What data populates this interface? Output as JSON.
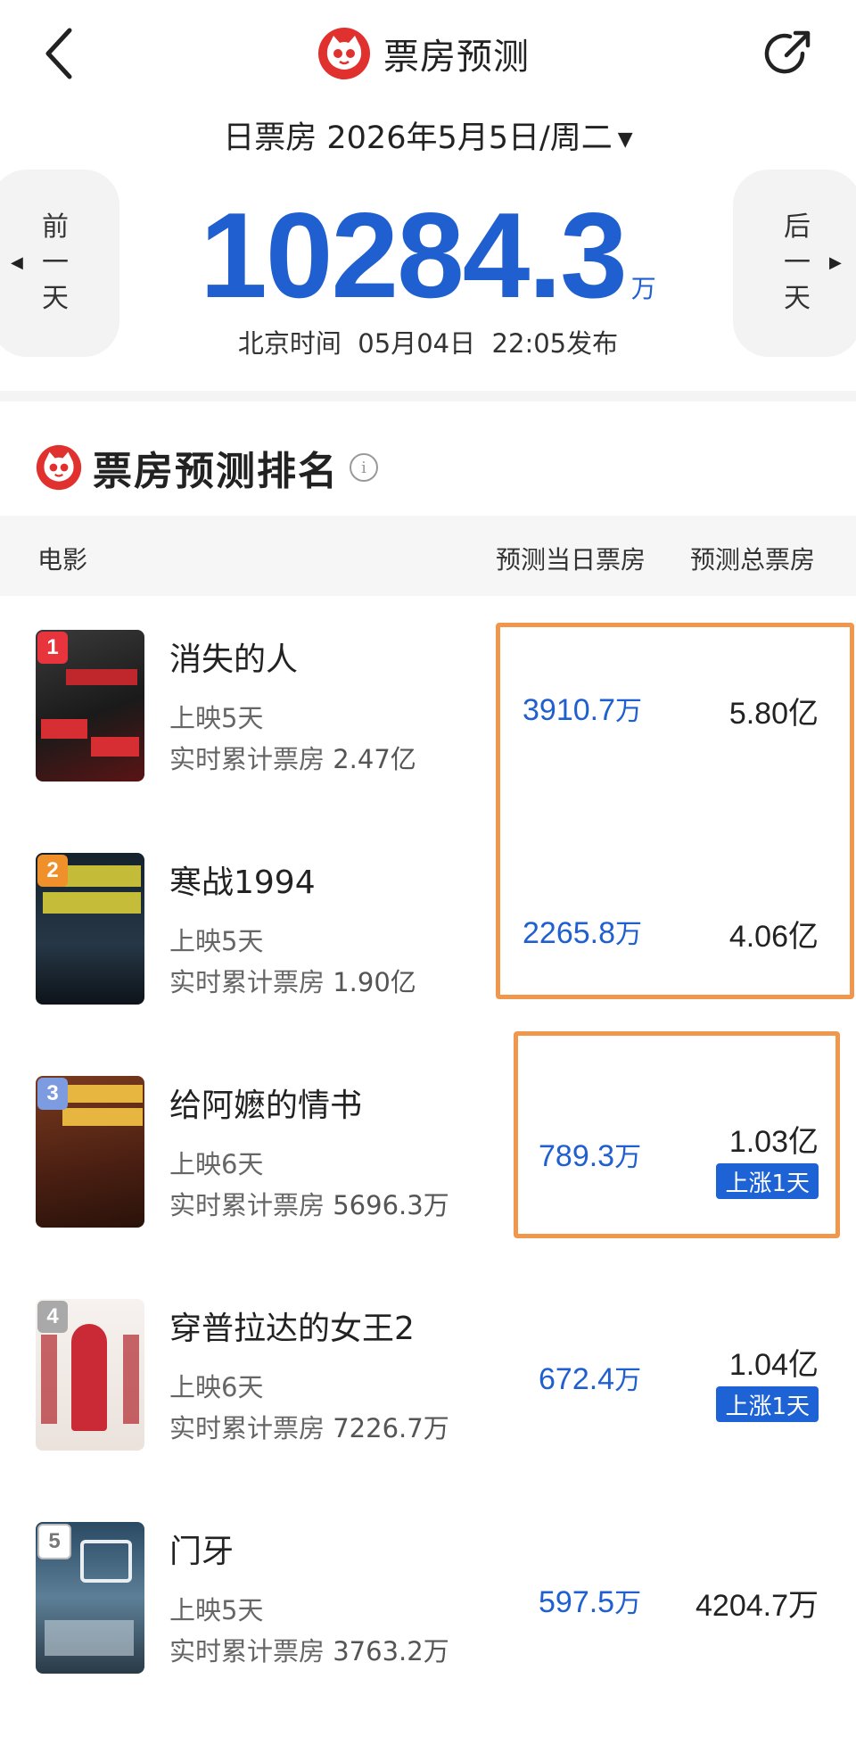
{
  "header": {
    "title": "票房预测",
    "date_label": "日票房 2026年5月5日/周二",
    "prev_label": [
      "前",
      "一",
      "天"
    ],
    "next_label": [
      "后",
      "一",
      "天"
    ],
    "total_value": "10284.3",
    "total_unit": "万",
    "publish_text": "北京时间  05月04日  22:05发布"
  },
  "section": {
    "title": "票房预测排名",
    "col_movie": "电影",
    "col_day": "预测当日票房",
    "col_total": "预测总票房"
  },
  "movies": [
    {
      "rank": "1",
      "title": "消失的人",
      "days": "上映5天",
      "cum_label": "实时累计票房",
      "cum": "2.47亿",
      "day_val": "3910.7",
      "day_unit": "万",
      "total": "5.80亿",
      "badge": ""
    },
    {
      "rank": "2",
      "title": "寒战1994",
      "days": "上映5天",
      "cum_label": "实时累计票房",
      "cum": "1.90亿",
      "day_val": "2265.8",
      "day_unit": "万",
      "total": "4.06亿",
      "badge": ""
    },
    {
      "rank": "3",
      "title": "给阿嬷的情书",
      "days": "上映6天",
      "cum_label": "实时累计票房",
      "cum": "5696.3万",
      "day_val": "789.3",
      "day_unit": "万",
      "total": "1.03亿",
      "badge": "上涨1天"
    },
    {
      "rank": "4",
      "title": "穿普拉达的女王2",
      "days": "上映6天",
      "cum_label": "实时累计票房",
      "cum": "7226.7万",
      "day_val": "672.4",
      "day_unit": "万",
      "total": "1.04亿",
      "badge": "上涨1天"
    },
    {
      "rank": "5",
      "title": "门牙",
      "days": "上映5天",
      "cum_label": "实时累计票房",
      "cum": "3763.2万",
      "day_val": "597.5",
      "day_unit": "万",
      "total": "4204.7万",
      "badge": ""
    }
  ],
  "colors": {
    "accent_blue": "#1f5fd0",
    "highlight_orange": "#f0974d",
    "brand_red": "#e0312f",
    "rank_colors": [
      "#e8343c",
      "#f0902a",
      "#7d9be0",
      "#a9a9a9",
      "#a9a9a9"
    ]
  },
  "icons": [
    "back-arrow-icon",
    "maoyan-cat-logo-icon",
    "share-icon",
    "caret-down-icon",
    "info-icon"
  ]
}
